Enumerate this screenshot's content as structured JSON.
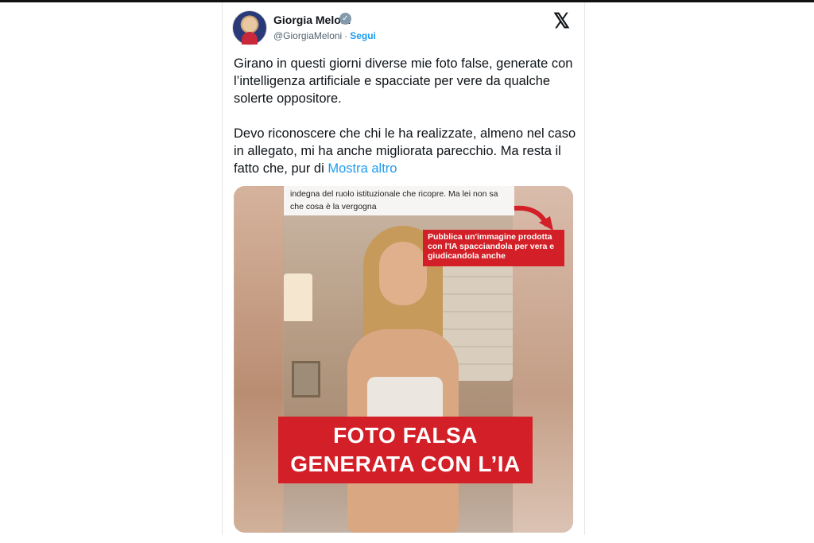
{
  "author": {
    "name": "Giorgia Meloni",
    "handle": "@GiorgiaMeloni",
    "separator": "·",
    "follow_label": "Segui"
  },
  "icons": {
    "verified": "verified-badge-icon",
    "logo": "x-logo-icon"
  },
  "logo_text": "𝕏",
  "tweet": {
    "paragraph1": "Girano in questi giorni diverse mie foto false, generate con l’intelligenza artificiale e spacciate per vere da qualche solerte oppositore.",
    "paragraph2": "Devo riconoscere che chi le ha realizzate, almeno nel caso in allegato, mi ha anche migliorata parecchio. Ma resta il fatto che, pur di",
    "show_more": "Mostra altro"
  },
  "media": {
    "quote_text": "indegna del ruolo istituzionale che ricopre. Ma lei non sa che cosa è la vergogna",
    "callout_text": "Pubblica un'immagine prodotta con l'IA spacciandola per vera e giudicandola anche",
    "banner_line1": "FOTO FALSA",
    "banner_line2": "GENERATA CON L’IA"
  },
  "colors": {
    "link": "#1d9bf0",
    "banner_red": "#d31f27",
    "verified_gray": "#829aab"
  }
}
